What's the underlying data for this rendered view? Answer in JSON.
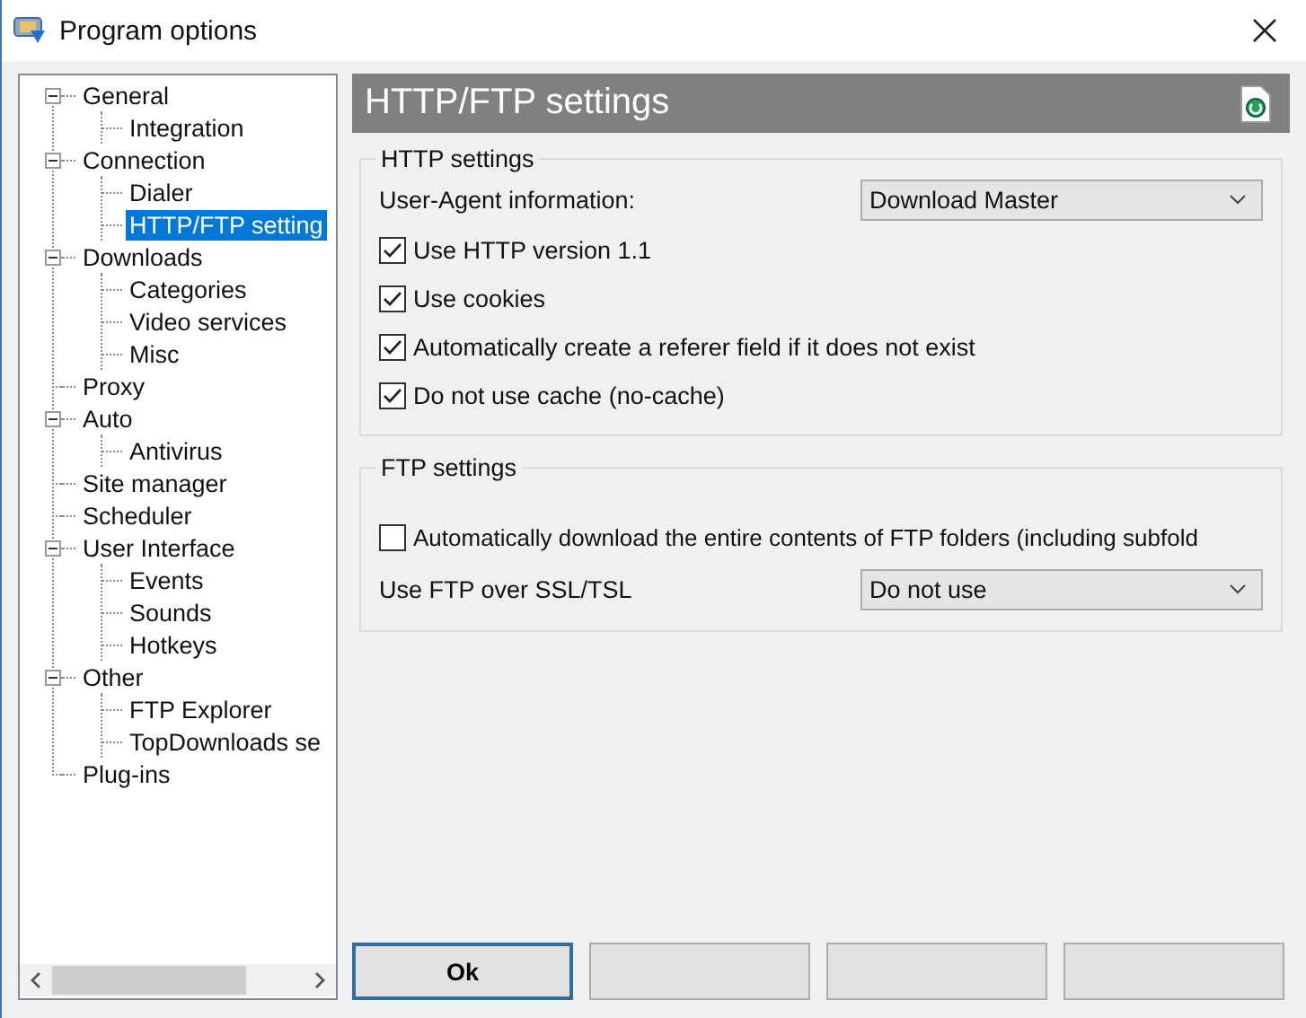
{
  "window": {
    "title": "Program options"
  },
  "tree": [
    {
      "label": "General",
      "selected": false,
      "expanded": true,
      "children": [
        {
          "label": "Integration",
          "selected": false
        }
      ]
    },
    {
      "label": "Connection",
      "selected": false,
      "expanded": true,
      "children": [
        {
          "label": "Dialer",
          "selected": false
        },
        {
          "label": "HTTP/FTP setting",
          "selected": true
        }
      ]
    },
    {
      "label": "Downloads",
      "selected": false,
      "expanded": true,
      "children": [
        {
          "label": "Categories",
          "selected": false
        },
        {
          "label": "Video services",
          "selected": false
        },
        {
          "label": "Misc",
          "selected": false
        }
      ]
    },
    {
      "label": "Proxy",
      "selected": false
    },
    {
      "label": "Auto",
      "selected": false,
      "expanded": true,
      "children": [
        {
          "label": "Antivirus",
          "selected": false
        }
      ]
    },
    {
      "label": "Site manager",
      "selected": false
    },
    {
      "label": "Scheduler",
      "selected": false
    },
    {
      "label": "User Interface",
      "selected": false,
      "expanded": true,
      "children": [
        {
          "label": "Events",
          "selected": false
        },
        {
          "label": "Sounds",
          "selected": false
        },
        {
          "label": "Hotkeys",
          "selected": false
        }
      ]
    },
    {
      "label": "Other",
      "selected": false,
      "expanded": true,
      "children": [
        {
          "label": "FTP Explorer",
          "selected": false
        },
        {
          "label": "TopDownloads se",
          "selected": false
        }
      ]
    },
    {
      "label": "Plug-ins",
      "selected": false
    }
  ],
  "page_title": "HTTP/FTP settings",
  "http_group": {
    "title": "HTTP settings",
    "user_agent": {
      "label": "User-Agent information:",
      "value": "Download Master"
    },
    "options": [
      {
        "label": "Use HTTP version 1.1",
        "checked": true
      },
      {
        "label": "Use cookies",
        "checked": true
      },
      {
        "label": "Automatically create a referer field if it does not exist",
        "checked": true
      },
      {
        "label": "Do not use cache (no-cache)",
        "checked": true
      }
    ]
  },
  "ftp_group": {
    "title": "FTP settings",
    "options": [
      {
        "label": "Automatically download the entire contents of FTP folders (including subfold",
        "checked": false
      }
    ],
    "ssl": {
      "label": "Use FTP over SSL/TSL",
      "value": "Do not use"
    }
  },
  "buttons": [
    {
      "label": "Ok",
      "default": true
    },
    {
      "default": false
    },
    {
      "default": false
    },
    {
      "default": false
    }
  ]
}
